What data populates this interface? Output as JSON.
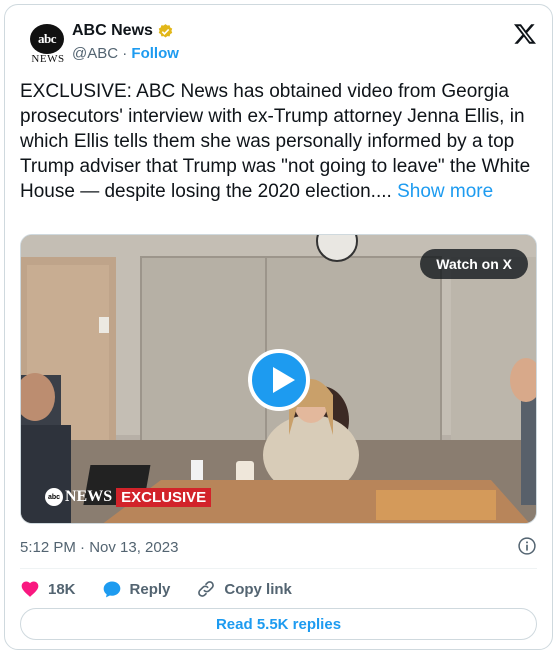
{
  "author": {
    "name": "ABC News",
    "handle": "@ABC",
    "separator": "·",
    "follow_label": "Follow",
    "avatar_text": "abc",
    "avatar_subtext": "NEWS"
  },
  "post": {
    "text": "EXCLUSIVE: ABC News has obtained video from Georgia prosecutors' interview with ex-Trump attorney Jenna Ellis, in which Ellis tells them she was personally informed by a top Trump adviser that Trump was \"not going to leave\" the White House — despite losing the 2020 election.... ",
    "show_more_label": "Show more",
    "timestamp": "5:12 PM · Nov 13, 2023"
  },
  "media": {
    "watch_label": "Watch on X",
    "badge_logo": "abc",
    "badge_news": "NEWS",
    "badge_exclusive": "EXCLUSIVE"
  },
  "actions": {
    "likes": "18K",
    "reply_label": "Reply",
    "copy_link_label": "Copy link"
  },
  "read_replies_label": "Read 5.5K replies",
  "icons": {
    "verified": "verified-badge-icon",
    "x_logo": "x-logo-icon",
    "info": "info-icon",
    "heart": "heart-icon",
    "reply": "reply-icon",
    "link": "link-icon",
    "play": "play-icon"
  },
  "colors": {
    "accent": "#1d9bf0",
    "heart": "#f91880",
    "verified": "#e2b719",
    "exclusive": "#d2232a",
    "text_secondary": "#536471"
  }
}
